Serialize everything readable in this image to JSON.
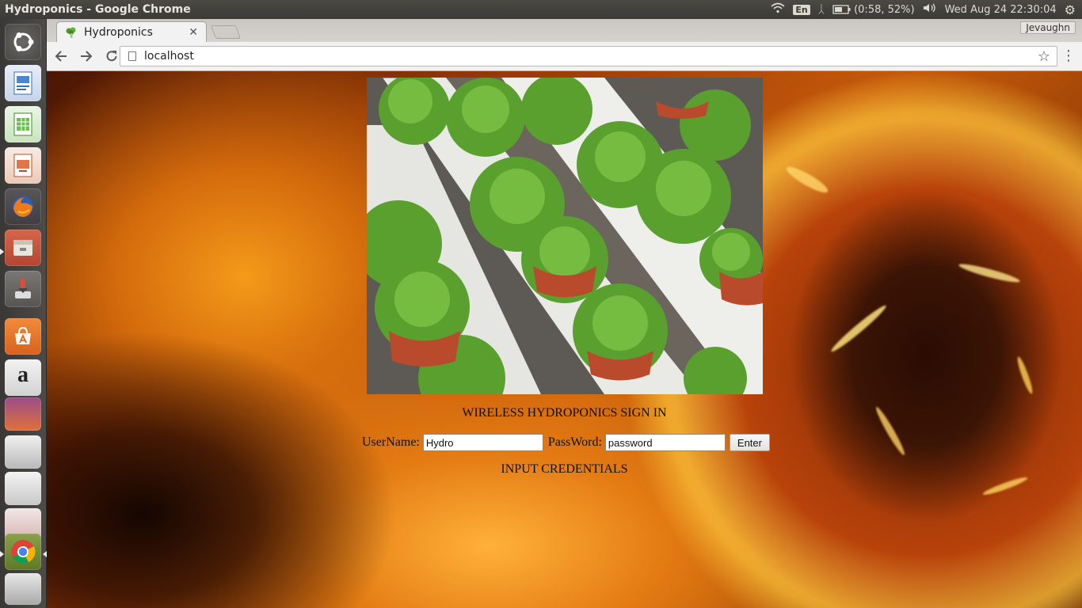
{
  "os_panel": {
    "window_title": "Hydroponics - Google Chrome",
    "keyboard_layout": "En",
    "battery": "(0:58, 52%)",
    "clock": "Wed Aug 24 22:30:04"
  },
  "launcher": {
    "items": [
      "ubuntu-dash",
      "libreoffice-writer",
      "libreoffice-calc",
      "libreoffice-impress",
      "firefox",
      "files",
      "installer",
      "software-center",
      "amazon",
      "app-stack-1",
      "app-stack-2",
      "app-stack-3",
      "app-stack-4",
      "chrome",
      "trash-stack"
    ]
  },
  "browser": {
    "tab_title": "Hydroponics",
    "profile_name": "Jevaughn",
    "url": "localhost"
  },
  "page": {
    "title": "WIRELESS HYDROPONICS SIGN IN",
    "username_label": "UserName:",
    "username_value": "Hydro",
    "password_label": "PassWord:",
    "password_value": "password",
    "enter_label": "Enter",
    "status_message": "INPUT CREDENTIALS"
  },
  "colors": {
    "panel": "#3b3a36",
    "launcher": "#3a3836",
    "chrome_frame": "#d9d6d2",
    "background_fire": "#e37a12"
  }
}
